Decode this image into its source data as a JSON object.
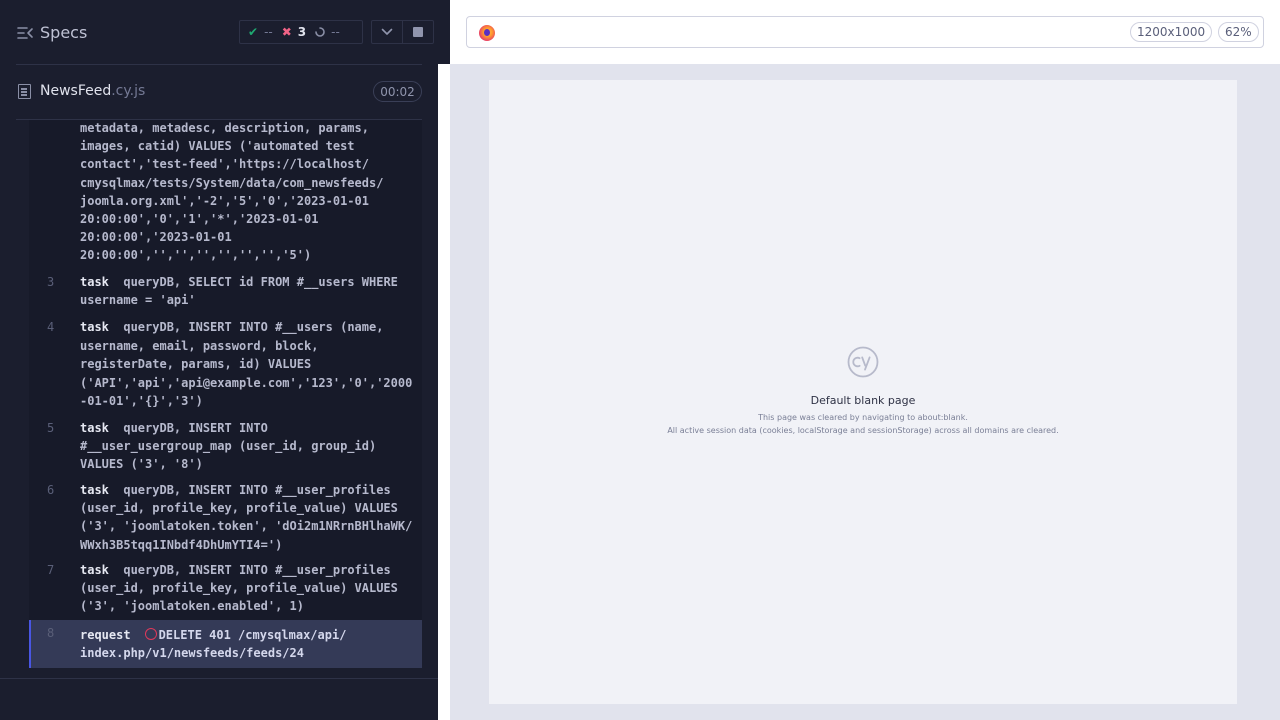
{
  "reporter": {
    "title": "Specs",
    "stats": {
      "passed": "--",
      "failed": "3",
      "pending": "--"
    },
    "spec_file": {
      "name": "NewsFeed",
      "ext": ".cy.js",
      "duration": "00:02"
    }
  },
  "commands": [
    {
      "number": "",
      "name": "",
      "message": "metadata, metadesc, description, params, images, catid) VALUES ('automated test contact','test-feed','https://localhost/cmysqlmax/tests/System/data/com_newsfeeds/joomla.org.xml','-2','5','0','2023-01-01 20:00:00','0','1','*','2023-01-01 20:00:00','2023-01-01 20:00:00','','','','','','','5')"
    },
    {
      "number": "3",
      "name": "task",
      "message": "queryDB, SELECT id FROM #__users WHERE username = 'api'"
    },
    {
      "number": "4",
      "name": "task",
      "message": "queryDB, INSERT INTO #__users (name, username, email, password, block, registerDate, params, id) VALUES ('API','api','api@example.com','123','0','2000-01-01','{}','3')"
    },
    {
      "number": "5",
      "name": "task",
      "message": "queryDB, INSERT INTO #__user_usergroup_map (user_id, group_id) VALUES ('3', '8')"
    },
    {
      "number": "6",
      "name": "task",
      "message": "queryDB, INSERT INTO #__user_profiles (user_id, profile_key, profile_value) VALUES ('3', 'joomlatoken.token', 'dOi2m1NRrnBHlhaWK/WWxh3B5tqq1INbdf4DhUmYTI4=')"
    },
    {
      "number": "7",
      "name": "task",
      "message": "queryDB, INSERT INTO #__user_profiles (user_id, profile_key, profile_value) VALUES ('3', 'joomlatoken.enabled', 1)"
    },
    {
      "number": "8",
      "name": "request",
      "message": "DELETE 401 /cmysqlmax/api/index.php/v1/newsfeeds/feeds/24"
    }
  ],
  "preview": {
    "viewport": "1200x1000",
    "zoom": "62%",
    "blank_title": "Default blank page",
    "blank_line1": "This page was cleared by navigating to about:blank.",
    "blank_line2": "All active session data (cookies, localStorage and sessionStorage) across all domains are cleared."
  },
  "colors": {
    "pass": "#1fa971",
    "fail": "#f06386",
    "accent": "#4956e3",
    "error": "#e0395a"
  },
  "icons": [
    "specs-toggle-icon",
    "check-icon",
    "x-icon",
    "spinner-icon",
    "chevron-down-icon",
    "stop-icon",
    "file-icon",
    "browser-icon",
    "cypress-logo-icon",
    "error-ring-icon"
  ]
}
